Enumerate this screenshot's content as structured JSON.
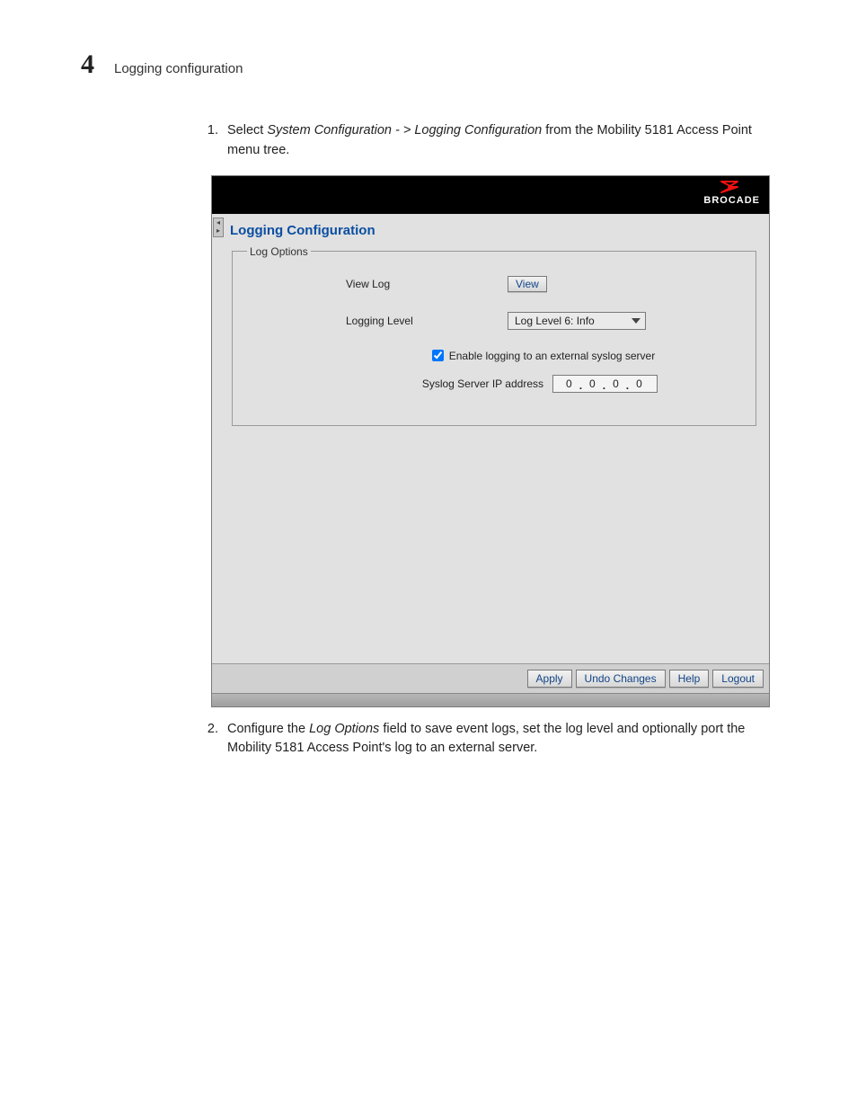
{
  "header": {
    "chapter_number": "4",
    "chapter_title": "Logging configuration"
  },
  "steps": {
    "one": {
      "num": "1.",
      "pre": "Select ",
      "path": "System Configuration - > Logging Configuration",
      "post": " from the Mobility 5181 Access Point menu tree."
    },
    "two": {
      "num": "2.",
      "pre": "Configure the ",
      "em": "Log Options",
      "post": " field to save event logs, set the log level and optionally port the Mobility 5181 Access Point's log to an external server."
    }
  },
  "shot": {
    "brand": "BROCADE",
    "panel_title": "Logging Configuration",
    "fieldset_legend": "Log Options",
    "rows": {
      "view_log_label": "View Log",
      "view_btn": "View",
      "logging_level_label": "Logging Level",
      "logging_level_value": "Log Level 6: Info",
      "enable_checkbox_label": "Enable logging to an external syslog server",
      "syslog_ip_label": "Syslog Server IP address",
      "ip_octets": [
        "0",
        "0",
        "0",
        "0"
      ]
    },
    "buttons": {
      "apply": "Apply",
      "undo": "Undo Changes",
      "help": "Help",
      "logout": "Logout"
    }
  }
}
